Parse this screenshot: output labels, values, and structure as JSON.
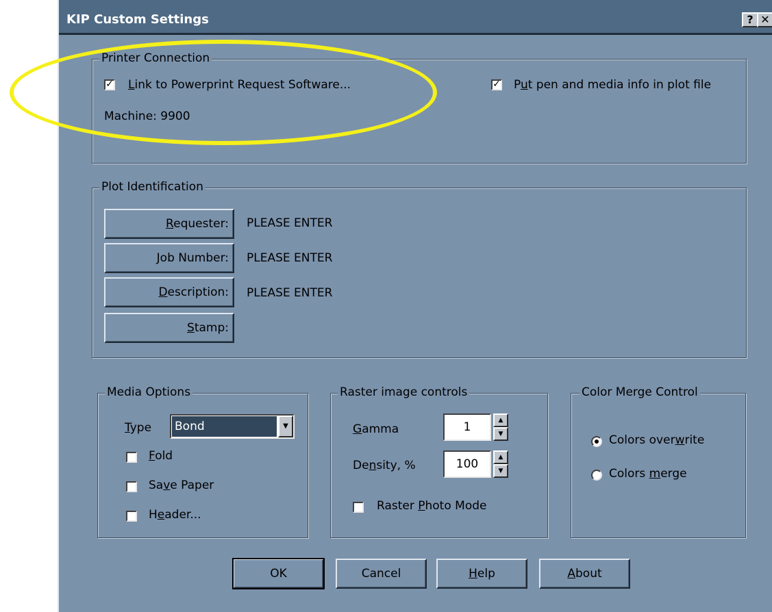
{
  "window": {
    "title": "KIP Custom Settings",
    "help_btn": "?",
    "close_btn": "✕"
  },
  "printer_connection": {
    "legend": "Printer Connection",
    "link_label_pre": "",
    "link_label_u": "L",
    "link_label_post": "ink to Powerprint Request Software...",
    "link_checked": true,
    "put_label_pre": "P",
    "put_label_u": "u",
    "put_label_post": "t pen and media info in plot file",
    "put_checked": true,
    "machine": "Machine: 9900"
  },
  "plot_identification": {
    "legend": "Plot Identification",
    "rows": [
      {
        "btn_pre": "",
        "btn_u": "R",
        "btn_post": "equester:",
        "value": "PLEASE ENTER"
      },
      {
        "btn_pre": "",
        "btn_u": "J",
        "btn_post": "ob Number:",
        "value": "PLEASE ENTER"
      },
      {
        "btn_pre": "",
        "btn_u": "D",
        "btn_post": "escription:",
        "value": "PLEASE ENTER"
      },
      {
        "btn_pre": "",
        "btn_u": "S",
        "btn_post": "tamp:",
        "value": ""
      }
    ]
  },
  "media_options": {
    "legend": "Media Options",
    "type_u": "T",
    "type_post": "ype",
    "type_value": "Bond",
    "fold_u": "F",
    "fold_post": "old",
    "save_pre": "Sa",
    "save_u": "v",
    "save_post": "e Paper",
    "header_pre": "H",
    "header_u": "e",
    "header_post": "ader...",
    "fold_checked": false,
    "save_checked": false,
    "header_checked": false
  },
  "raster": {
    "legend": "Raster image controls",
    "gamma_u": "G",
    "gamma_post": "amma",
    "gamma_value": "1",
    "density_pre": "De",
    "density_u": "n",
    "density_post": "sity, %",
    "density_value": "100",
    "photo_pre": "Raster ",
    "photo_u": "P",
    "photo_post": "hoto Mode",
    "photo_checked": false
  },
  "color_merge": {
    "legend": "Color Merge Control",
    "overwrite_pre": "Colors over",
    "overwrite_u": "w",
    "overwrite_post": "rite",
    "merge_pre": "Colors ",
    "merge_u": "m",
    "merge_post": "erge",
    "selected": "overwrite"
  },
  "buttons": {
    "ok": "OK",
    "cancel": "Cancel",
    "help_u": "H",
    "help_post": "elp",
    "about_u": "A",
    "about_post": "bout"
  },
  "annotation": {
    "color": "#f4f01a"
  },
  "colors": {
    "dialog_bg": "#7b92ab",
    "titlebar_bg": "#4f6a85"
  }
}
